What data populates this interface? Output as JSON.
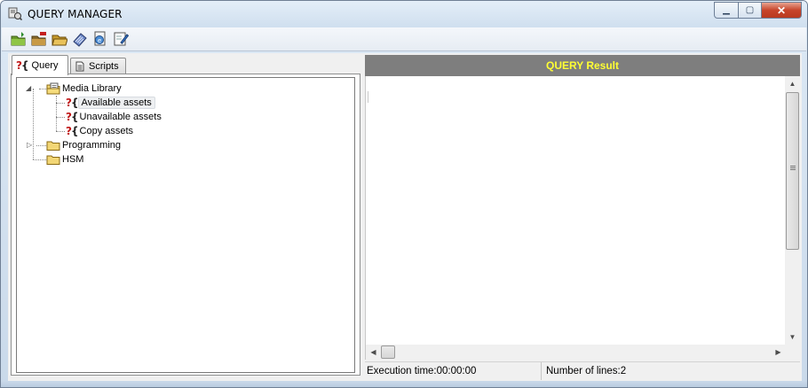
{
  "window": {
    "title": "QUERY MANAGER",
    "minimize_glyph": "▁",
    "maximize_glyph": "▢",
    "close_glyph": "✕"
  },
  "toolbar": {
    "icons": [
      "add-query-icon",
      "delete-query-icon",
      "open-folder-icon",
      "execute-icon",
      "export-icon",
      "edit-icon"
    ]
  },
  "left": {
    "tabs": [
      {
        "label": "Query",
        "icon": "query-icon",
        "active": true
      },
      {
        "label": "Scripts",
        "icon": "script-icon",
        "active": false
      }
    ],
    "tree": {
      "root": {
        "label": "Media Library",
        "expanded": true
      },
      "children": [
        {
          "label": "Available assets",
          "selected": true
        },
        {
          "label": "Unavailable assets",
          "selected": false
        },
        {
          "label": "Copy assets",
          "selected": false
        }
      ],
      "folders": [
        {
          "label": "Programming",
          "has_children": true
        },
        {
          "label": "HSM",
          "has_children": false
        }
      ]
    }
  },
  "right": {
    "header": "QUERY Result",
    "header_color": "#ffff33",
    "status": {
      "execution_time": "Execution time:00:00:00",
      "number_of_lines": "Number of lines:2"
    }
  }
}
